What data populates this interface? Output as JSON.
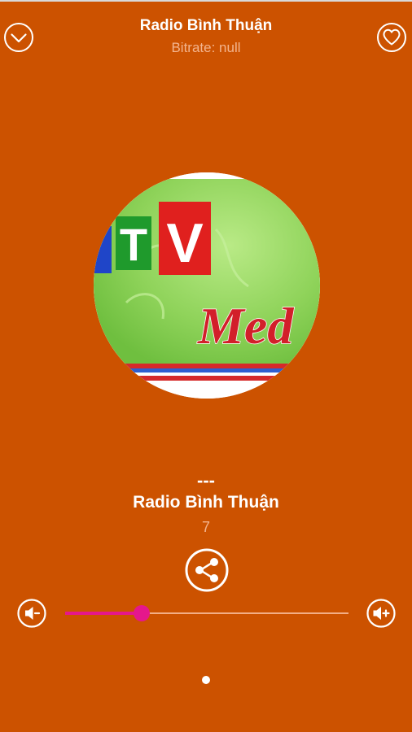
{
  "header": {
    "title": "Radio Bình Thuận",
    "subtitle": "Bitrate: null",
    "left_icon": "chevron-down-circle-icon",
    "right_icon": "heart-icon"
  },
  "cover": {
    "logo_text": "TV",
    "logo_script": "Med"
  },
  "player": {
    "track": "---",
    "station": "Radio Bình Thuận",
    "number": "7",
    "share_icon": "share-icon"
  },
  "volume": {
    "level": 0.27,
    "down_icon": "volume-down-icon",
    "up_icon": "volume-up-icon"
  },
  "pager": {
    "pages": 1,
    "current": 0
  },
  "colors": {
    "background": "#cc5200",
    "accent": "#e5178c",
    "secondary_text": "#f3b48e"
  }
}
